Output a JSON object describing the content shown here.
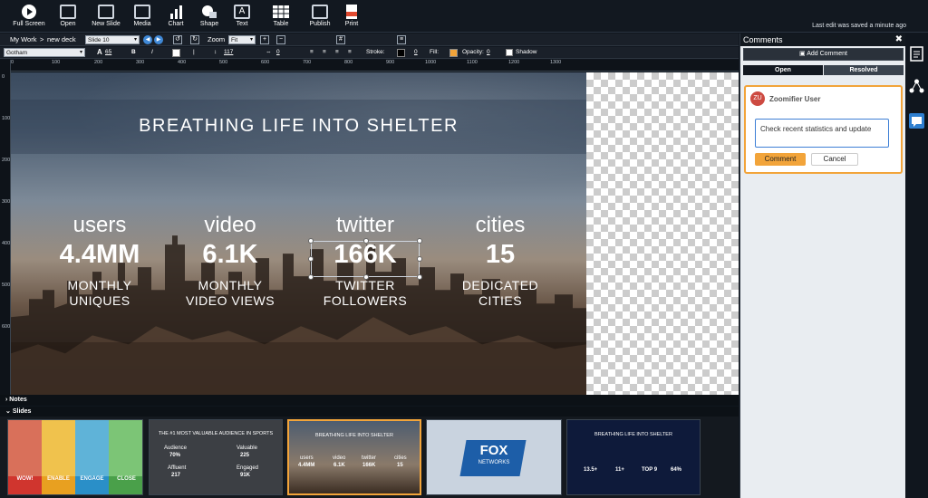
{
  "toolbar": {
    "items": [
      "Full Screen",
      "Open",
      "New Slide",
      "Media",
      "Chart",
      "Shape",
      "Text",
      "Table",
      "Publish",
      "Print"
    ],
    "status": "Last edit was saved a minute ago"
  },
  "nav": {
    "crumb_root": "My Work",
    "crumb_sep": ">",
    "crumb_deck": "new deck",
    "slide_select": "Slide 10",
    "zoom_label": "Zoom",
    "zoom_select": "Fit"
  },
  "format": {
    "font_select": "Gotham",
    "font_size_label": "A",
    "font_size": "65",
    "bold": "B",
    "italic": "I",
    "line_height": "117",
    "letter_spacing": "0",
    "stroke_label": "Stroke:",
    "stroke_value": "0",
    "fill_label": "Fill:",
    "opacity_label": "Opacity:",
    "opacity_value": "0",
    "shadow_label": "Shadow",
    "fill_color": "#f2a43a"
  },
  "ruler": {
    "top_ticks": [
      "0",
      "100",
      "200",
      "300",
      "400",
      "500",
      "600",
      "700",
      "800",
      "900",
      "1000",
      "1100",
      "1200",
      "1300"
    ],
    "left_ticks": [
      "0",
      "100",
      "200",
      "300",
      "400",
      "500",
      "600"
    ]
  },
  "slide": {
    "title": "BREATHING LIFE INTO SHELTER",
    "stats": [
      {
        "label": "users",
        "value": "4.4MM",
        "sub1": "MONTHLY",
        "sub2": "UNIQUES"
      },
      {
        "label": "video",
        "value": "6.1K",
        "sub1": "MONTHLY",
        "sub2": "VIDEO VIEWS"
      },
      {
        "label": "twitter",
        "value": "166K",
        "sub1": "TWITTER",
        "sub2": "FOLLOWERS"
      },
      {
        "label": "cities",
        "value": "15",
        "sub1": "DEDICATED",
        "sub2": "CITIES"
      }
    ]
  },
  "sections": {
    "notes": "Notes",
    "slides": "Slides"
  },
  "thumbnails": {
    "t1": [
      "WOW!",
      "ENABLE",
      "ENGAGE",
      "CLOSE"
    ],
    "t2": {
      "title": "THE #1 MOST VALUABLE AUDIENCE IN SPORTS",
      "cells": [
        "Audience",
        "70%",
        "Valuable",
        "225",
        "Affluent",
        "217",
        "Engaged",
        "91K"
      ]
    },
    "t3": {
      "title": "BREATHING LIFE INTO SHELTER",
      "cells": [
        "users",
        "4.4MM",
        "video",
        "6.1K",
        "twitter",
        "166K",
        "cities",
        "15"
      ]
    },
    "t4": {
      "logo_top": "FOX",
      "logo_bottom": "NETWORKS"
    },
    "t5": {
      "title": "BREATHING LIFE INTO SHELTER",
      "cells": [
        "13.5+",
        "11+",
        "TOP 9",
        "64%"
      ]
    }
  },
  "comments": {
    "title": "Comments",
    "close": "✖",
    "add_button": "Add Comment",
    "tab_open": "Open",
    "tab_resolved": "Resolved",
    "avatar_initials": "ZU",
    "user_name": "Zoomifier User",
    "draft_text": "Check recent statistics and update",
    "submit_label": "Comment",
    "cancel_label": "Cancel"
  }
}
